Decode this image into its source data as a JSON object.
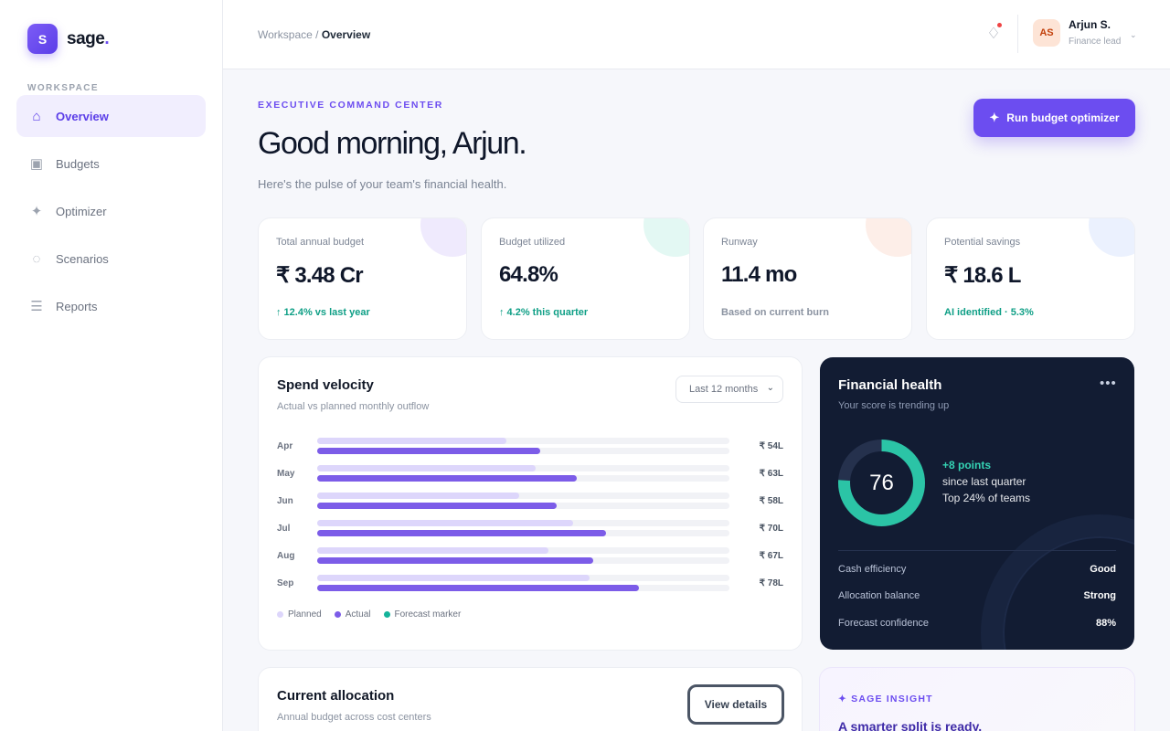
{
  "brand": {
    "mark": "S",
    "name": "sage",
    "dot": "."
  },
  "sidebar": {
    "section_label": "WORKSPACE",
    "items": [
      {
        "label": "Overview",
        "icon": "⌂",
        "icon_name": "home-icon",
        "active": true
      },
      {
        "label": "Budgets",
        "icon": "▣",
        "icon_name": "wallet-icon",
        "active": false
      },
      {
        "label": "Optimizer",
        "icon": "✦",
        "icon_name": "sparkle-icon",
        "active": false
      },
      {
        "label": "Scenarios",
        "icon": "◌",
        "icon_name": "scenario-icon",
        "active": false
      },
      {
        "label": "Reports",
        "icon": "☰",
        "icon_name": "reports-icon",
        "active": false
      }
    ]
  },
  "topbar": {
    "breadcrumb_parent": "Workspace / ",
    "breadcrumb_current": "Overview",
    "notification_icon": "♢",
    "user": {
      "initials": "AS",
      "name": "Arjun S.",
      "role": "Finance lead",
      "caret": "⌄"
    }
  },
  "hero": {
    "eyebrow": "EXECUTIVE COMMAND CENTER",
    "greeting": "Good morning, Arjun.",
    "subtitle": "Here's the pulse of your team's financial health.",
    "cta_icon": "✦",
    "cta_label": "Run budget optimizer"
  },
  "kpis": [
    {
      "label": "Total annual budget",
      "value": "₹ 3.48 Cr",
      "foot": "↑ 12.4% vs last year",
      "foot_color": "#0f9f86",
      "blob_color": "#efeafd"
    },
    {
      "label": "Budget utilized",
      "value": "64.8%",
      "foot": "↑ 4.2% this quarter",
      "foot_color": "#0f9f86",
      "blob_color": "#e3f8f3"
    },
    {
      "label": "Runway",
      "value": "11.4 mo",
      "foot": "Based on current burn",
      "foot_color": "#8b93a1",
      "blob_color": "#fdeee8"
    },
    {
      "label": "Potential savings",
      "value": "₹ 18.6 L",
      "foot": "AI identified · 5.3%",
      "foot_color": "#0f9f86",
      "blob_color": "#ebf1fe"
    }
  ],
  "spend_velocity": {
    "title": "Spend velocity",
    "subtitle": "Actual vs planned monthly outflow",
    "period": "Last 12 months",
    "colors": {
      "planned": "#ddd6fb",
      "actual": "#7c5ce8",
      "forecast": "#14b39a"
    },
    "legend": [
      "Planned",
      "Actual",
      "Forecast marker"
    ],
    "chart_data": {
      "type": "bar",
      "categories": [
        "Apr",
        "May",
        "Jun",
        "Jul",
        "Aug",
        "Sep"
      ],
      "series": [
        {
          "name": "Planned",
          "values": [
            0.46,
            0.53,
            0.49,
            0.62,
            0.56,
            0.66
          ]
        },
        {
          "name": "Actual",
          "values": [
            0.54,
            0.63,
            0.58,
            0.7,
            0.67,
            0.78
          ]
        }
      ],
      "value_labels": [
        "₹ 54L",
        "₹ 63L",
        "₹ 58L",
        "₹ 70L",
        "₹ 67L",
        "₹ 78L"
      ]
    }
  },
  "health": {
    "title": "Financial health",
    "subtitle": "Your score is trending up",
    "more_icon": "•••",
    "score": 76,
    "score_text": "76",
    "points": "+8 points",
    "since": "since last quarter",
    "rank": "Top 24% of teams",
    "gauge_color": "#2bc4a6",
    "rows": [
      {
        "label": "Cash efficiency",
        "value": "Good"
      },
      {
        "label": "Allocation balance",
        "value": "Strong"
      },
      {
        "label": "Forecast confidence",
        "value": "88%"
      }
    ]
  },
  "allocation": {
    "title": "Current allocation",
    "subtitle": "Annual budget across cost centers",
    "button": "View details"
  },
  "insight": {
    "eyebrow": "✦ SAGE INSIGHT",
    "title": "A smarter split is ready."
  }
}
